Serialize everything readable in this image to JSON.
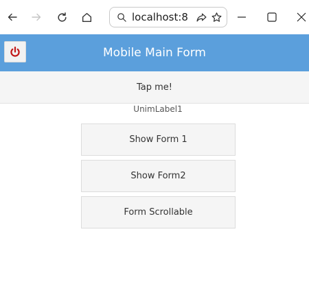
{
  "browser": {
    "url": "localhost:8",
    "icons": {
      "back": "arrow-left-icon",
      "forward": "arrow-right-icon",
      "refresh": "refresh-icon",
      "home": "home-icon",
      "search": "search-icon",
      "share": "share-icon",
      "favorite": "star-icon",
      "minimize": "minimize-icon",
      "maximize": "maximize-icon",
      "close": "close-icon"
    }
  },
  "header": {
    "title": "Mobile Main Form",
    "power_icon": "power-icon",
    "background_color": "#5b9fdc",
    "power_color": "#c21818"
  },
  "tap_button": {
    "label": "Tap me!"
  },
  "label1": {
    "text": "UnimLabel1"
  },
  "buttons": {
    "show_form1": "Show Form 1",
    "show_form2": "Show Form2",
    "form_scrollable": "Form Scrollable"
  }
}
